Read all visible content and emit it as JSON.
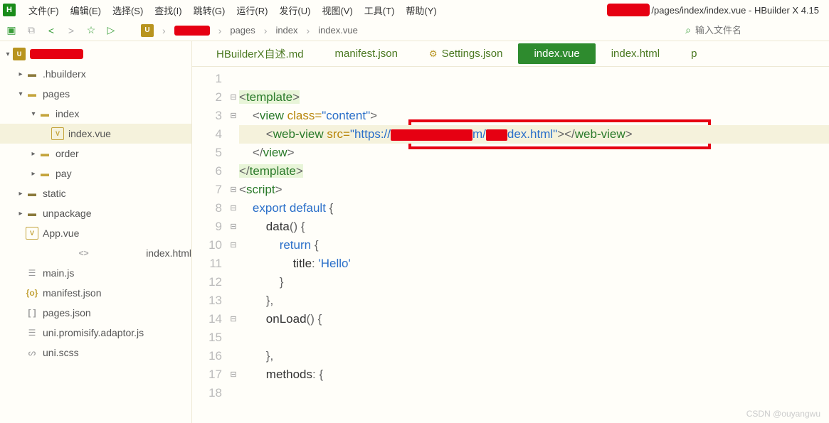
{
  "menubar": {
    "items": [
      "文件(F)",
      "编辑(E)",
      "选择(S)",
      "查找(I)",
      "跳转(G)",
      "运行(R)",
      "发行(U)",
      "视图(V)",
      "工具(T)",
      "帮助(Y)"
    ],
    "title_path": "/pages/index/index.vue - HBuilder X 4.15"
  },
  "toolbar": {
    "crumbs": [
      "pages",
      "index",
      "index.vue"
    ],
    "search_placeholder": "输入文件名"
  },
  "sidebar": {
    "tree": [
      {
        "depth": 0,
        "arrow": "down",
        "icon": "proj",
        "label": "",
        "redacted": true
      },
      {
        "depth": 1,
        "arrow": "right",
        "icon": "folder-dark",
        "label": ".hbuilderx"
      },
      {
        "depth": 1,
        "arrow": "down",
        "icon": "folder",
        "label": "pages"
      },
      {
        "depth": 2,
        "arrow": "down",
        "icon": "folder",
        "label": "index"
      },
      {
        "depth": 3,
        "arrow": "",
        "icon": "vue",
        "label": "index.vue",
        "selected": true
      },
      {
        "depth": 2,
        "arrow": "right",
        "icon": "folder",
        "label": "order"
      },
      {
        "depth": 2,
        "arrow": "right",
        "icon": "folder",
        "label": "pay"
      },
      {
        "depth": 1,
        "arrow": "right",
        "icon": "folder-dark",
        "label": "static"
      },
      {
        "depth": 1,
        "arrow": "right",
        "icon": "folder-dark",
        "label": "unpackage"
      },
      {
        "depth": 1,
        "arrow": "",
        "icon": "vue",
        "label": "App.vue"
      },
      {
        "depth": 1,
        "arrow": "",
        "icon": "code",
        "label": "index.html"
      },
      {
        "depth": 1,
        "arrow": "",
        "icon": "js",
        "label": "main.js"
      },
      {
        "depth": 1,
        "arrow": "",
        "icon": "json",
        "label": "manifest.json"
      },
      {
        "depth": 1,
        "arrow": "",
        "icon": "brackets",
        "label": "pages.json"
      },
      {
        "depth": 1,
        "arrow": "",
        "icon": "js",
        "label": "uni.promisify.adaptor.js"
      },
      {
        "depth": 1,
        "arrow": "",
        "icon": "scss",
        "label": "uni.scss"
      }
    ]
  },
  "tabs": {
    "items": [
      {
        "label": "HBuilderX自述.md",
        "active": false,
        "gear": false
      },
      {
        "label": "manifest.json",
        "active": false,
        "gear": false
      },
      {
        "label": "Settings.json",
        "active": false,
        "gear": true
      },
      {
        "label": "index.vue",
        "active": true,
        "gear": false
      },
      {
        "label": "index.html",
        "active": false,
        "gear": false
      },
      {
        "label": "p",
        "active": false,
        "gear": false
      }
    ]
  },
  "code": {
    "lines": [
      {
        "n": 1,
        "fold": "",
        "html": ""
      },
      {
        "n": 2,
        "fold": "⊟",
        "html": "<span class='hl-tag'><span class='t-punc'>&lt;</span><span class='t-tag'>template</span><span class='t-punc'>&gt;</span></span>"
      },
      {
        "n": 3,
        "fold": "⊟",
        "html": "    <span class='t-punc'>&lt;</span><span class='t-tag'>view</span> <span class='t-attr'>class</span><span class='t-op'>=</span><span class='t-str'>\"content\"</span><span class='t-punc'>&gt;</span>"
      },
      {
        "n": 4,
        "fold": "",
        "html": "        <span class='t-punc'>&lt;</span><span class='t-tag'>web-view</span> <span class='t-attr'>src</span><span class='t-op'>=</span><span class='t-str'>\"https://<span class='red-fill' style='width:115px'></span>m/<span class='red-fill' style='width:30px'></span>dex.html\"</span><span class='t-punc'>&gt;</span><span class='t-punc'>&lt;/</span><span class='t-tag'>web-view</span><span class='t-punc'>&gt;</span>",
        "hl": true
      },
      {
        "n": 5,
        "fold": "",
        "html": "    <span class='t-punc'>&lt;/</span><span class='t-tag'>view</span><span class='t-punc'>&gt;</span>"
      },
      {
        "n": 6,
        "fold": "",
        "html": "<span class='hl-tag'><span class='t-punc'>&lt;/</span><span class='t-tag'>template</span><span class='t-punc'>&gt;</span></span>"
      },
      {
        "n": 7,
        "fold": "⊟",
        "html": "<span class='t-punc'>&lt;</span><span class='t-tag'>script</span><span class='t-punc'>&gt;</span>"
      },
      {
        "n": 8,
        "fold": "⊟",
        "html": "    <span class='t-kw'>export</span> <span class='t-kw'>default</span> <span class='t-punc'>{</span>"
      },
      {
        "n": 9,
        "fold": "⊟",
        "html": "        <span class='t-id'>data</span><span class='t-punc'>() {</span>"
      },
      {
        "n": 10,
        "fold": "⊟",
        "html": "            <span class='t-kw'>return</span> <span class='t-punc'>{</span>"
      },
      {
        "n": 11,
        "fold": "",
        "html": "                <span class='t-id'>title</span><span class='t-punc'>:</span> <span class='t-str'>'Hello'</span>"
      },
      {
        "n": 12,
        "fold": "",
        "html": "            <span class='t-punc'>}</span>"
      },
      {
        "n": 13,
        "fold": "",
        "html": "        <span class='t-punc'>},</span>"
      },
      {
        "n": 14,
        "fold": "⊟",
        "html": "        <span class='t-id'>onLoad</span><span class='t-punc'>() {</span>"
      },
      {
        "n": 15,
        "fold": "",
        "html": ""
      },
      {
        "n": 16,
        "fold": "",
        "html": "        <span class='t-punc'>},</span>"
      },
      {
        "n": 17,
        "fold": "⊟",
        "html": "        <span class='t-id'>methods</span><span class='t-punc'>: {</span>"
      },
      {
        "n": 18,
        "fold": "",
        "html": ""
      }
    ]
  },
  "watermark": "CSDN @ouyangwu"
}
